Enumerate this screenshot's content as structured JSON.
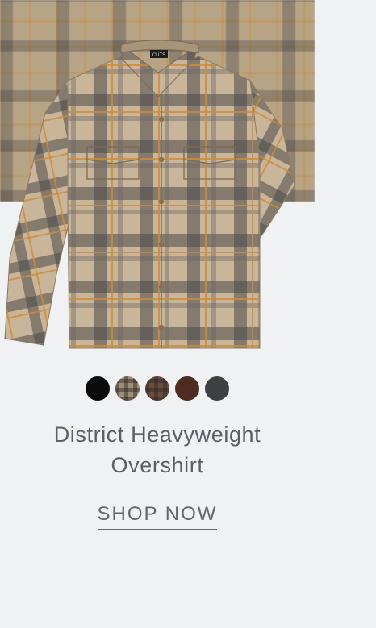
{
  "product": {
    "title_line1": "District Heavyweight",
    "title_line2": "Overshirt",
    "cta_label": "SHOP NOW",
    "image_icon": "plaid-overshirt-image",
    "brand_tag": "CUTS"
  },
  "swatches": [
    {
      "name": "black",
      "color": "#0b0b0b"
    },
    {
      "name": "tan-plaid",
      "color": "#a08d74"
    },
    {
      "name": "brown-plaid",
      "color": "#6e4a3a"
    },
    {
      "name": "brown",
      "color": "#4e2b20"
    },
    {
      "name": "charcoal",
      "color": "#3f4043"
    }
  ],
  "colors": {
    "background": "#f0f1f3",
    "text": "#5b5f66"
  }
}
